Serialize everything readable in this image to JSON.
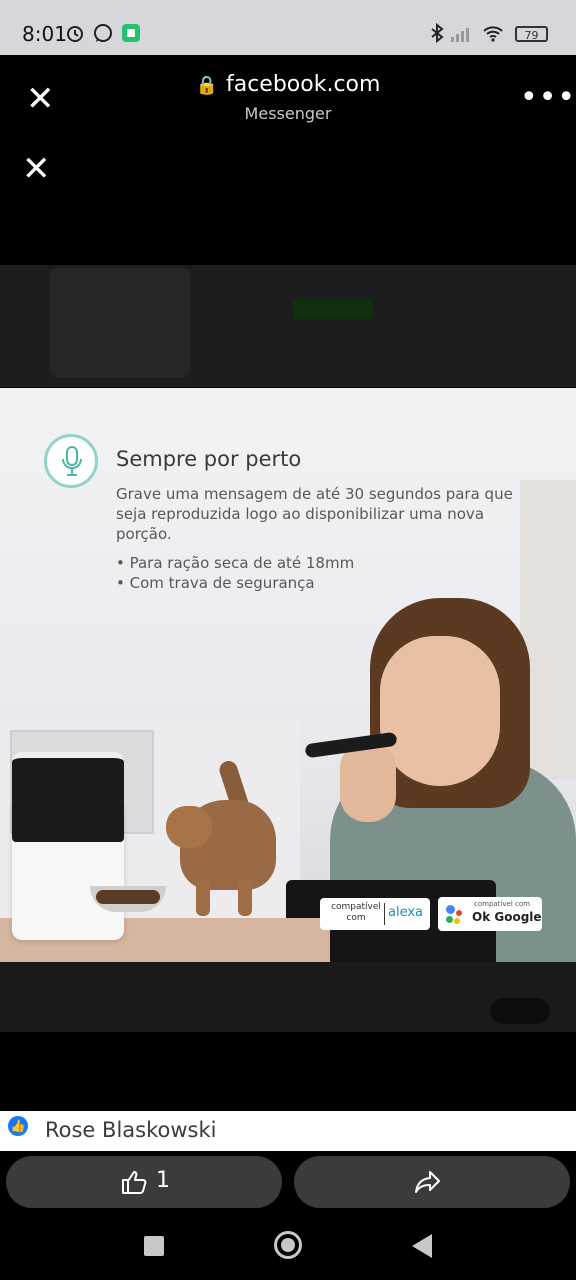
{
  "status_bar": {
    "time": "8:01",
    "battery": "79"
  },
  "browser": {
    "domain": "facebook.com",
    "subtitle": "Messenger"
  },
  "ad": {
    "headline": "Sempre por perto",
    "body": "Grave uma mensagem de até 30 segundos para que seja reproduzida logo ao disponibilizar uma nova porção.",
    "bullets": [
      "• Para ração seca de até 18mm",
      "• Com trava de segurança"
    ],
    "badge_alexa_small": "compatível com",
    "badge_alexa": "alexa",
    "badge_google_small": "compatível com",
    "badge_google": "Ok Google"
  },
  "reactions": {
    "name": "Rose Blaskowski"
  },
  "actions": {
    "like_count": "1"
  },
  "colors": {
    "like_blue": "#1877f2",
    "button_bg": "#3a3b3c"
  }
}
